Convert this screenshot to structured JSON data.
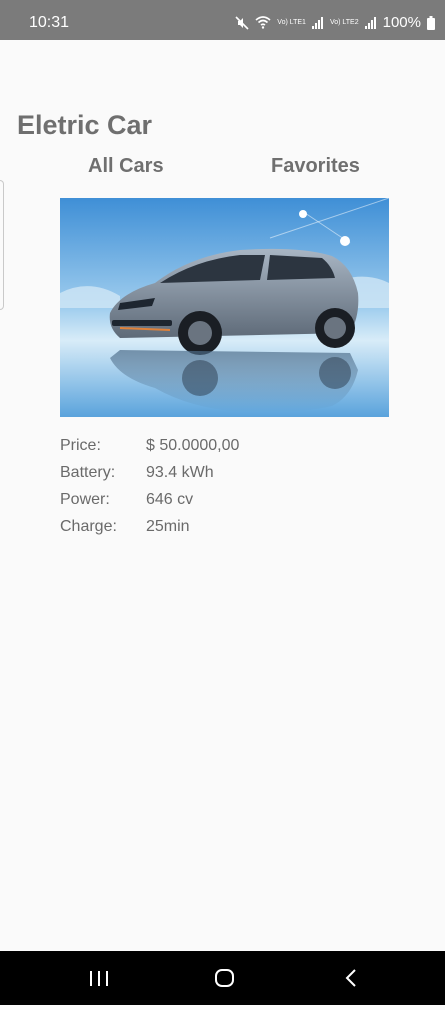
{
  "status_bar": {
    "time": "10:31",
    "battery_text": "100%",
    "net1": "Vo) LTE1",
    "net2": "Vo) LTE2",
    "icons": [
      "mute-icon",
      "wifi-icon",
      "signal-icon",
      "battery-icon"
    ]
  },
  "app": {
    "title": "Eletric Car",
    "tabs": [
      {
        "label": "All Cars"
      },
      {
        "label": "Favorites"
      }
    ]
  },
  "car": {
    "specs": [
      {
        "label": "Price:",
        "value": "$ 50.0000,00"
      },
      {
        "label": "Battery:",
        "value": "93.4 kWh"
      },
      {
        "label": "Power:",
        "value": "646 cv"
      },
      {
        "label": "Charge:",
        "value": "25min"
      }
    ]
  },
  "nav": {
    "icons": [
      "recents-icon",
      "home-icon",
      "back-icon"
    ]
  },
  "colors": {
    "status_bar_bg": "#7b7b7b",
    "text_gray": "#6f6f6f",
    "background": "#fafafa",
    "nav_bg": "#000000"
  }
}
